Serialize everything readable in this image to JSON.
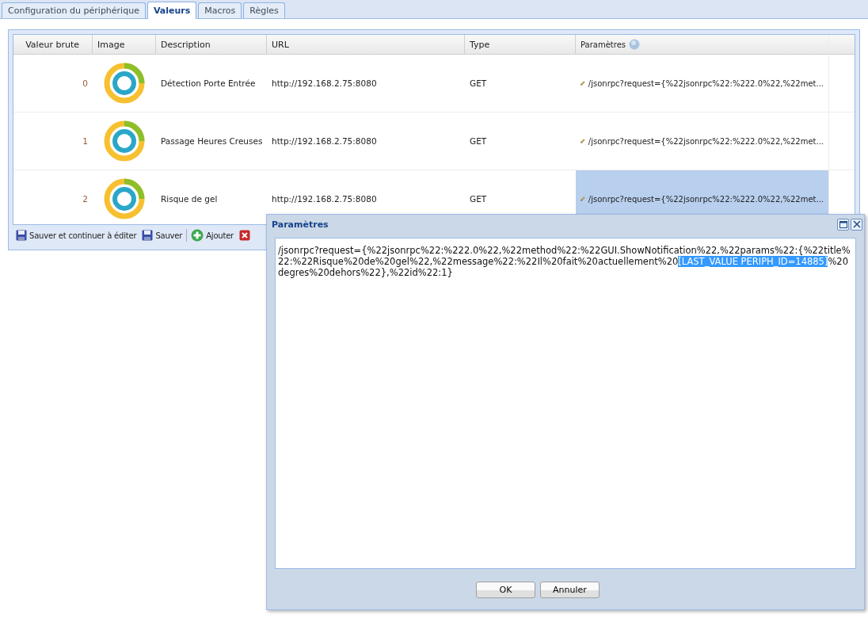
{
  "tabs": [
    {
      "label": "Configuration du périphérique",
      "selected": false
    },
    {
      "label": "Valeurs",
      "selected": true
    },
    {
      "label": "Macros",
      "selected": false
    },
    {
      "label": "Règles",
      "selected": false
    }
  ],
  "table": {
    "columns": [
      "Valeur brute",
      "Image",
      "Description",
      "URL",
      "Type",
      "Paramètres"
    ],
    "rows": [
      {
        "value": "0",
        "description": "Détection Porte Entrée",
        "url": "http://192.168.2.75:8080",
        "type": "GET",
        "params": "/jsonrpc?request={%22jsonrpc%22:%222.0%22,%22met...",
        "params_selected": false
      },
      {
        "value": "1",
        "description": "Passage Heures Creuses",
        "url": "http://192.168.2.75:8080",
        "type": "GET",
        "params": "/jsonrpc?request={%22jsonrpc%22:%222.0%22,%22met...",
        "params_selected": false
      },
      {
        "value": "2",
        "description": "Risque de gel",
        "url": "http://192.168.2.75:8080",
        "type": "GET",
        "params": "/jsonrpc?request={%22jsonrpc%22:%222.0%22,%22met...",
        "params_selected": true
      }
    ]
  },
  "toolbar": [
    {
      "kind": "save",
      "label": "Sauver et continuer à éditer"
    },
    {
      "kind": "save",
      "label": "Sauver"
    },
    {
      "kind": "separator"
    },
    {
      "kind": "add",
      "label": "Ajouter"
    },
    {
      "kind": "delete"
    }
  ],
  "dialog": {
    "title": "Paramètres",
    "text_before": "/jsonrpc?request={%22jsonrpc%22:%222.0%22,%22method%22:%22GUI.ShowNotification%22,%22params%22:{%22title%22:%22Risque%20de%20gel%22,%22message%22:%22Il%20fait%20actuellement%20",
    "text_selected": "[LAST_VALUE PERIPH_ID=14885]",
    "text_after": "%20degres%20dehors%22},%22id%22:1}",
    "buttons": [
      "OK",
      "Annuler"
    ]
  }
}
